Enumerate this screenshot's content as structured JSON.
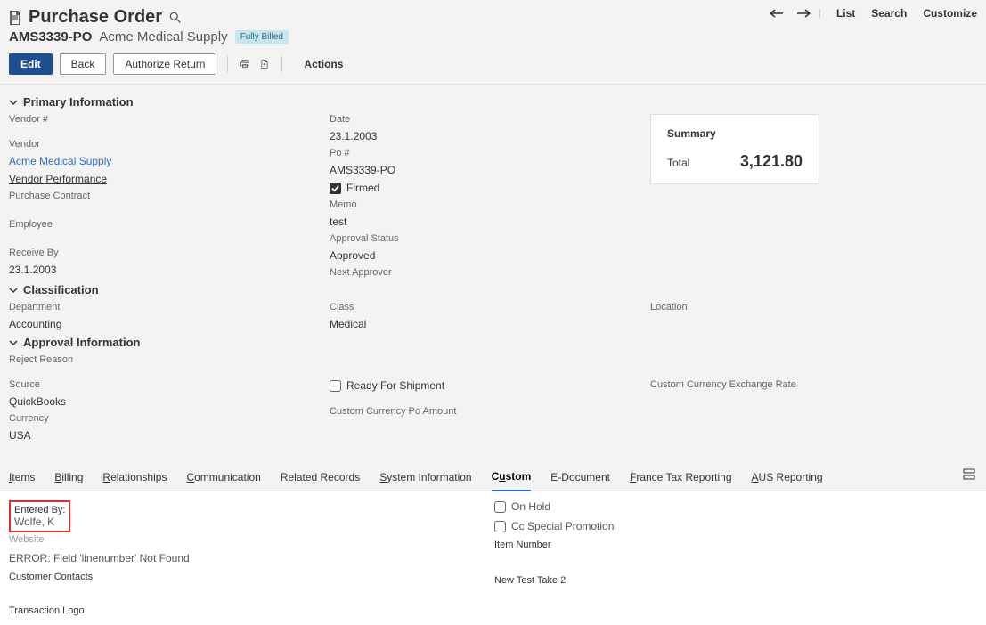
{
  "header": {
    "title": "Purchase Order",
    "po_number": "AMS3339-PO",
    "vendor_name": "Acme Medical Supply",
    "status_badge": "Fully Billed"
  },
  "top_actions": {
    "list": "List",
    "search": "Search",
    "customize": "Customize"
  },
  "toolbar": {
    "edit": "Edit",
    "back": "Back",
    "authorize_return": "Authorize Return",
    "actions": "Actions"
  },
  "sections": {
    "primary": {
      "title": "Primary Information",
      "vendor_num_label": "Vendor #",
      "vendor_label": "Vendor",
      "vendor_value": "Acme Medical Supply",
      "vendor_perf": "Vendor Performance",
      "purchase_contract_label": "Purchase Contract",
      "employee_label": "Employee",
      "receive_by_label": "Receive By",
      "receive_by_value": "23.1.2003",
      "date_label": "Date",
      "date_value": "23.1.2003",
      "po_num_label": "Po #",
      "po_num_value": "AMS3339-PO",
      "firmed_label": "Firmed",
      "memo_label": "Memo",
      "memo_value": "test",
      "approval_status_label": "Approval Status",
      "approval_status_value": "Approved",
      "next_approver_label": "Next Approver"
    },
    "classification": {
      "title": "Classification",
      "department_label": "Department",
      "department_value": "Accounting",
      "class_label": "Class",
      "class_value": "Medical",
      "location_label": "Location"
    },
    "approval": {
      "title": "Approval Information",
      "reject_reason_label": "Reject Reason"
    },
    "misc": {
      "source_label": "Source",
      "source_value": "QuickBooks",
      "currency_label": "Currency",
      "currency_value": "USA",
      "ready_for_shipment": "Ready For Shipment",
      "custom_currency_po": "Custom Currency Po Amount",
      "custom_currency_rate": "Custom Currency Exchange Rate"
    }
  },
  "summary": {
    "title": "Summary",
    "total_label": "Total",
    "total_value": "3,121.80"
  },
  "tabs": {
    "items": "Items",
    "billing": "Billing",
    "relationships": "Relationships",
    "communication": "Communication",
    "related": "Related Records",
    "system": "System Information",
    "custom": "Custom",
    "edoc": "E-Document",
    "france": "France Tax Reporting",
    "aus": "AUS Reporting"
  },
  "custom_tab": {
    "entered_by_label": "Entered By:",
    "entered_by_value": "Wolfe, K",
    "website_label": "Website",
    "website_value": "ERROR: Field 'linenumber' Not Found",
    "customer_contacts_label": "Customer Contacts",
    "transaction_logo_label": "Transaction Logo",
    "on_hold": "On Hold",
    "cc_special": "Cc Special Promotion",
    "item_number": "Item Number",
    "new_test": "New Test Take 2"
  }
}
